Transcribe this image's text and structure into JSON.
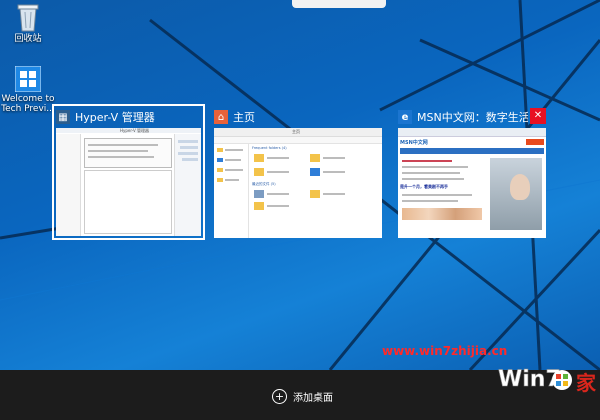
{
  "desktop": {
    "icons": [
      {
        "name": "recycle-bin",
        "label": "回收站"
      },
      {
        "name": "welcome-shortcut",
        "label": "Welcome to Tech Previ..."
      }
    ]
  },
  "task_view": {
    "windows": [
      {
        "id": "hyperv",
        "title": "Hyper-V 管理器",
        "selected": true,
        "icon": "hyperv-icon",
        "inner_title": "Hyper-V 管理器"
      },
      {
        "id": "explorer",
        "title": "主页",
        "selected": false,
        "icon": "home-icon",
        "inner_title": "主页"
      },
      {
        "id": "msn",
        "title": "MSN中文网：数字生活 ...",
        "selected": false,
        "icon": "edge-icon",
        "inner_banner": "MSN中文网",
        "inner_caption": "是升一个月，看美剧不再手"
      }
    ],
    "close_label": "✕"
  },
  "explorer_sections": {
    "frequent": "Frequent folders (4)",
    "recent": "最近的文件 (5)"
  },
  "taskbar": {
    "add_desktop_label": "添加桌面"
  },
  "watermark": {
    "url": "www.win7zhijia.cn",
    "logo_text": "Win7 之家"
  },
  "colors": {
    "wallpaper": "#0a66bf",
    "taskbar": "#1c1c1c",
    "close": "#e81123",
    "watermark": "#ff2a2a"
  }
}
